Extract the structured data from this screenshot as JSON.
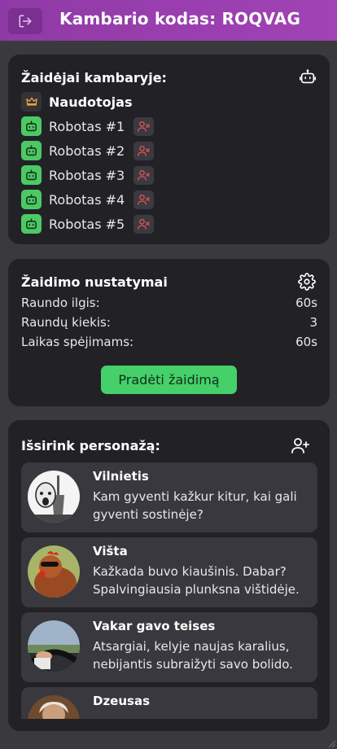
{
  "header": {
    "title": "Kambario kodas: ROQVAG",
    "leave_icon": "logout-icon",
    "colors": {
      "gradient_start": "#8e3aa6",
      "gradient_end": "#a043b4",
      "button": "#7a2f91"
    }
  },
  "players": {
    "title": "Žaidėjai kambaryje:",
    "add_bot_icon": "robot-icon",
    "host": {
      "name": "Naudotojas",
      "icon": "crown-icon"
    },
    "bots": [
      {
        "name": "Robotas #1",
        "icon": "robot-icon",
        "kick_icon": "remove-user-icon"
      },
      {
        "name": "Robotas #2",
        "icon": "robot-icon",
        "kick_icon": "remove-user-icon"
      },
      {
        "name": "Robotas #3",
        "icon": "robot-icon",
        "kick_icon": "remove-user-icon"
      },
      {
        "name": "Robotas #4",
        "icon": "robot-icon",
        "kick_icon": "remove-user-icon"
      },
      {
        "name": "Robotas #5",
        "icon": "robot-icon",
        "kick_icon": "remove-user-icon"
      }
    ]
  },
  "settings": {
    "title": "Žaidimo nustatymai",
    "icon": "gear-icon",
    "rows": [
      {
        "label": "Raundo ilgis:",
        "value": "60s"
      },
      {
        "label": "Raundų kiekis:",
        "value": "3"
      },
      {
        "label": "Laikas spėjimams:",
        "value": "60s"
      }
    ],
    "start_label": "Pradėti žaidimą",
    "start_color": "#45d06a"
  },
  "characters": {
    "title": "Išsirink personažą:",
    "icon": "add-user-icon",
    "items": [
      {
        "name": "Vilnietis",
        "description": "Kam gyventi kažkur kitur, kai gali gyventi sostinėje?"
      },
      {
        "name": "Višta",
        "description": "Kažkada buvo kiaušinis. Dabar? Spalvingiausia plunksna vištidėje."
      },
      {
        "name": "Vakar gavo teises",
        "description": "Atsargiai, kelyje naujas karalius, nebijantis subraižyti savo bolido."
      },
      {
        "name": "Dzeusas",
        "description": ""
      }
    ]
  }
}
